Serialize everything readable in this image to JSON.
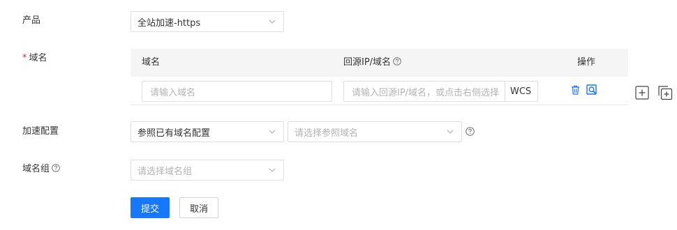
{
  "form": {
    "product": {
      "label": "产品",
      "value": "全站加速-https"
    },
    "domain": {
      "required_mark": "*",
      "label": "域名",
      "table": {
        "col_domain": "域名",
        "col_origin": "回源IP/域名",
        "col_action": "操作",
        "row": {
          "domain_placeholder": "请输入域名",
          "origin_placeholder": "请输入回源IP/域名，或点击右侧选择",
          "origin_suffix": "WCS"
        }
      }
    },
    "accel_config": {
      "label": "加速配置",
      "mode_value": "参照已有域名配置",
      "ref_placeholder": "请选择参照域名"
    },
    "domain_group": {
      "label": "域名组",
      "placeholder": "请选择域名组"
    }
  },
  "actions": {
    "submit": "提交",
    "cancel": "取消"
  },
  "icons": {
    "delete": "trash-icon",
    "preview": "search-doc-icon",
    "add_row": "plus-square-icon",
    "copy_row": "copy-add-icon",
    "help": "question-circle-icon",
    "dropdown": "chevron-down-icon"
  },
  "colors": {
    "primary": "#1677ff",
    "required": "#f5222d",
    "border": "#dcdfe6",
    "table_header_bg": "#f5f5f5",
    "placeholder": "#b3b3b3"
  }
}
